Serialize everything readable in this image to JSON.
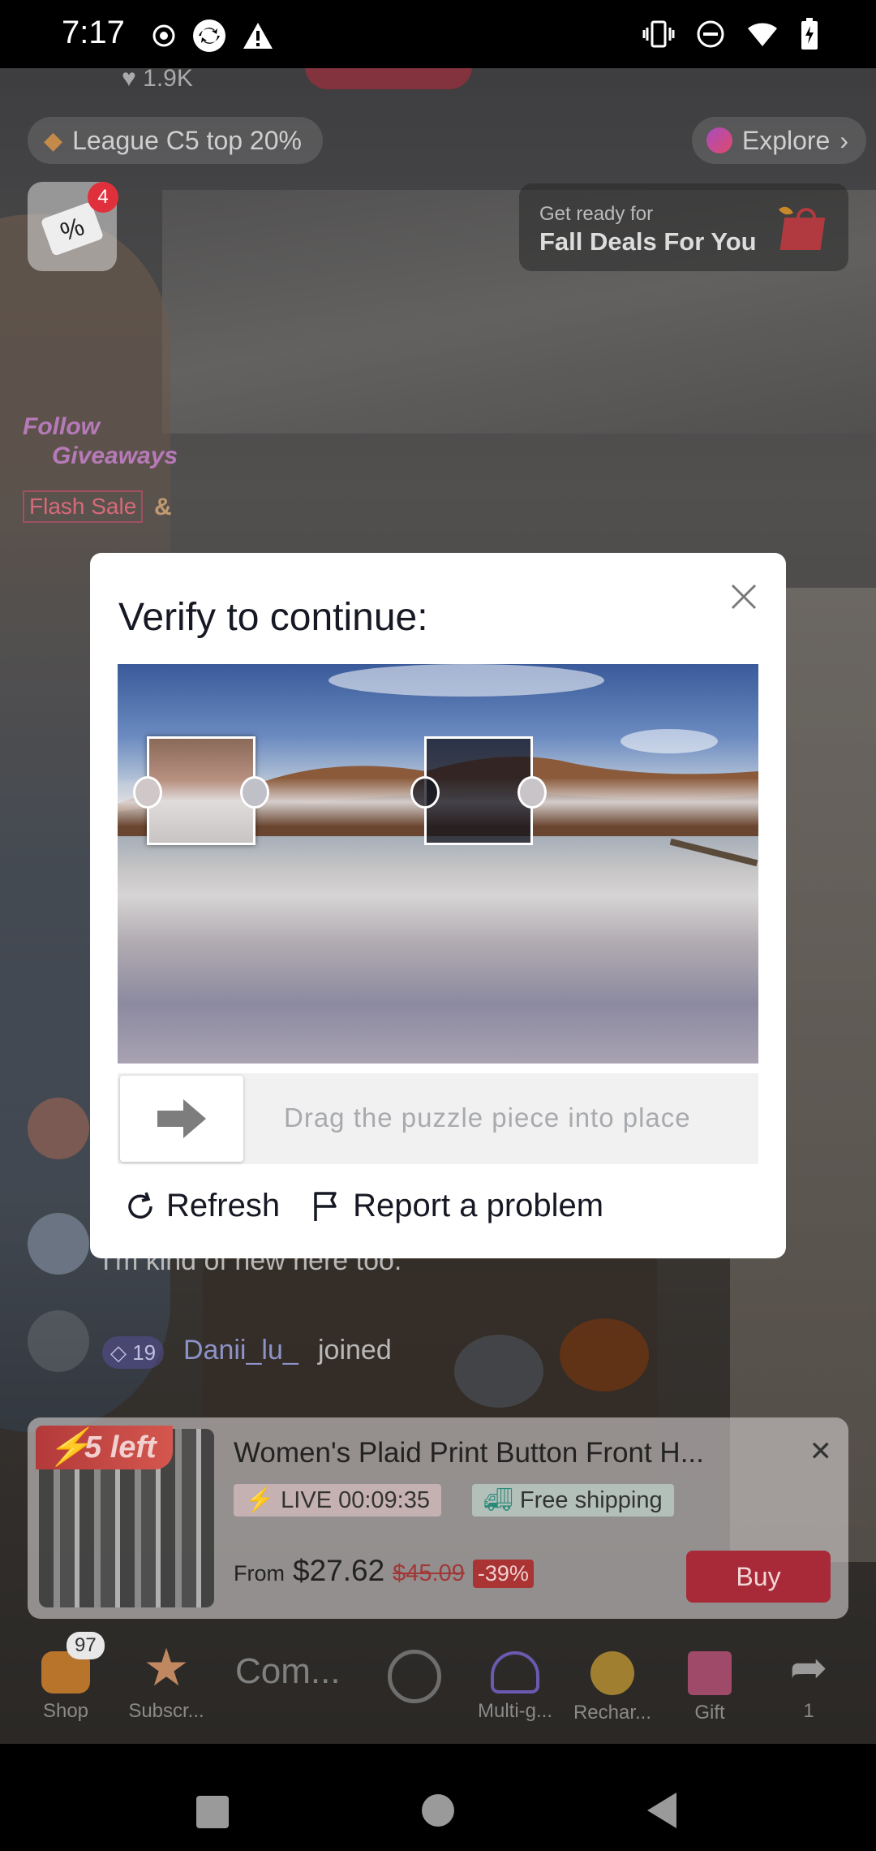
{
  "status_bar": {
    "time": "7:17",
    "left_icons": [
      "record-icon",
      "sync-icon",
      "warning-icon"
    ],
    "right_icons": [
      "vibrate-icon",
      "dnd-icon",
      "wifi-icon",
      "battery-icon"
    ]
  },
  "live": {
    "host_likes": "1.9K",
    "league": "League C5 top 20%",
    "explore": "Explore",
    "coupon_badge": "4",
    "coupon_symbol": "%",
    "deals_sub": "Get ready for",
    "deals_title": "Fall Deals For You",
    "overlay_follow": "Follow",
    "overlay_giveaways": "Giveaways",
    "overlay_flash": "Flash Sale",
    "overlay_amp": "&",
    "chat": [
      {
        "text": "I'm kind of new here too."
      }
    ],
    "join": {
      "level": "19",
      "user": "Danii_lu_",
      "action": "joined"
    }
  },
  "product": {
    "stock": "5 left",
    "title": "Women's Plaid Print Button Front H...",
    "live_timer": "LIVE 00:09:35",
    "shipping": "Free shipping",
    "from_label": "From",
    "price": "$27.62",
    "original_price": "$45.09",
    "discount": "-39%",
    "buy_label": "Buy"
  },
  "toolbar": {
    "shop_badge": "97",
    "items": [
      {
        "label": "Shop"
      },
      {
        "label": "Subscr..."
      },
      {
        "label": "Multi-g..."
      },
      {
        "label": "Rechar..."
      },
      {
        "label": "Gift"
      },
      {
        "label": "1"
      }
    ],
    "comment_placeholder": "Com..."
  },
  "modal": {
    "title": "Verify to continue:",
    "slider_hint": "Drag the puzzle piece into place",
    "refresh_label": "Refresh",
    "report_label": "Report a problem"
  },
  "colors": {
    "accent_red": "#a82a38",
    "modal_text": "#161823",
    "hint_gray": "#a9aaae"
  }
}
